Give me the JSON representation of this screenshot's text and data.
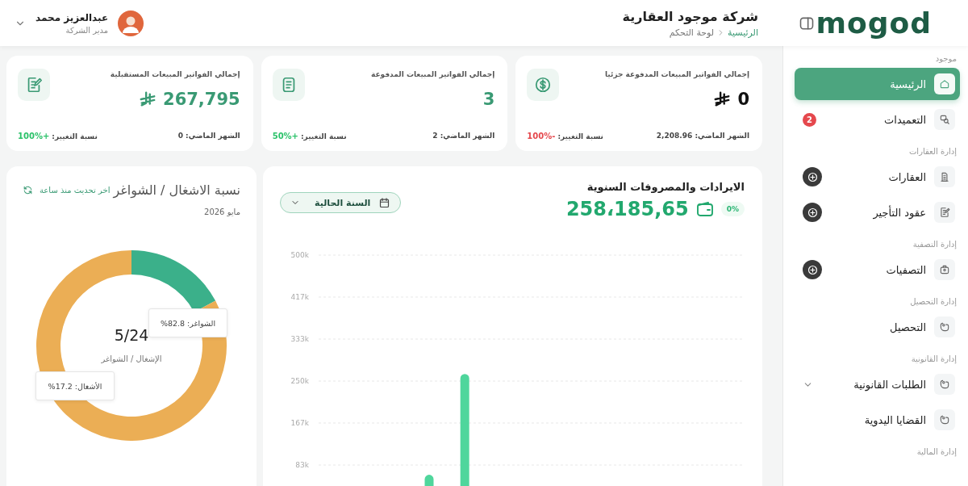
{
  "header": {
    "logo": "mogod",
    "company": "شركة موجود العقارية",
    "breadcrumb": [
      {
        "label": "الرئيسية",
        "link": true
      },
      {
        "label": "لوحة التحكم",
        "link": false
      }
    ],
    "user": {
      "name": "عبدالعزيز محمد",
      "role": "مدير الشركة"
    }
  },
  "sidebar": {
    "groups": [
      {
        "label": "موجود",
        "items": [
          {
            "label": "الرئيسية",
            "kind": "plain",
            "selected": true
          },
          {
            "label": "التعميدات",
            "kind": "plain",
            "selected": false,
            "badge": "2"
          }
        ]
      },
      {
        "label": "إدارة العقارات",
        "items": [
          {
            "label": "العقارات",
            "kind": "add",
            "selected": false
          },
          {
            "label": "عقود التأجير",
            "kind": "add",
            "selected": false
          }
        ]
      },
      {
        "label": "إدارة التصفية",
        "items": [
          {
            "label": "التصفيات",
            "kind": "add",
            "selected": false
          }
        ]
      },
      {
        "label": "إدارة التحصيل",
        "items": [
          {
            "label": "التحصيل",
            "kind": "plain",
            "selected": false
          }
        ]
      },
      {
        "label": "إدارة القانونية",
        "items": [
          {
            "label": "الطلبات القانونية",
            "kind": "expandable",
            "selected": false,
            "expanded": false
          },
          {
            "label": "القضايا اليدوية",
            "kind": "plain",
            "selected": false
          }
        ]
      },
      {
        "label": "إدارة المالية"
      }
    ]
  },
  "stats": [
    {
      "title": "إجمالي الفواتير المبيعات المدفوعة جزئيا",
      "value": {
        "text": "0",
        "color": "#111111"
      },
      "currency": true,
      "last_month": "الشهر الماضي: 2,208.96",
      "change_label": "نسبة التغيير:",
      "change": {
        "text": "-100%",
        "color": "#e5484d"
      }
    },
    {
      "title": "إجمالي الفواتير المبيعات المدفوعة",
      "value": {
        "text": "3",
        "color": "#3a9a74"
      },
      "currency": false,
      "last_month": "الشهر الماضي: 2",
      "change_label": "نسبة التغيير:",
      "change": {
        "text": "+50%",
        "color": "#2cc26a"
      }
    },
    {
      "title": "إجمالي الفواتير المبيعات المستقبلية",
      "value": {
        "text": "267,795",
        "color": "#3a9a74"
      },
      "currency": true,
      "last_month": "الشهر الماضي: 0",
      "change_label": "نسبة التغيير:",
      "change": {
        "text": "+100%",
        "color": "#2cc26a"
      }
    }
  ],
  "revenue": {
    "title": "الايرادات والمصروفات السنوية",
    "change": "0%",
    "amount": "258،185,65",
    "period": "السنة الحالية",
    "chart_data": {
      "type": "bar",
      "grid": true,
      "ylim": [
        0,
        500000
      ],
      "yticks": [
        {
          "value": 83333,
          "label": "83k"
        },
        {
          "value": 166667,
          "label": "167k"
        },
        {
          "value": 250000,
          "label": "250k"
        },
        {
          "value": 333333,
          "label": "333k"
        },
        {
          "value": 416667,
          "label": "417k"
        },
        {
          "value": 500000,
          "label": "500k"
        }
      ],
      "values": [
        0,
        0,
        0,
        64000,
        264000,
        0,
        0,
        0,
        0,
        0,
        0,
        0
      ]
    }
  },
  "occupancy": {
    "title": "نسبة الاشغال / الشواغر",
    "updated": "اخر تحديث منذ ساعة",
    "date": "مايو 2026",
    "center_value": "5/24",
    "center_label": "الإشغال / الشواغر",
    "chart_data": {
      "type": "donut",
      "values": [
        17.2,
        82.8
      ],
      "annotations": [
        {
          "text": "الشواغر: 82.8%"
        },
        {
          "text": "الأشغال: 17.2%"
        }
      ]
    }
  }
}
